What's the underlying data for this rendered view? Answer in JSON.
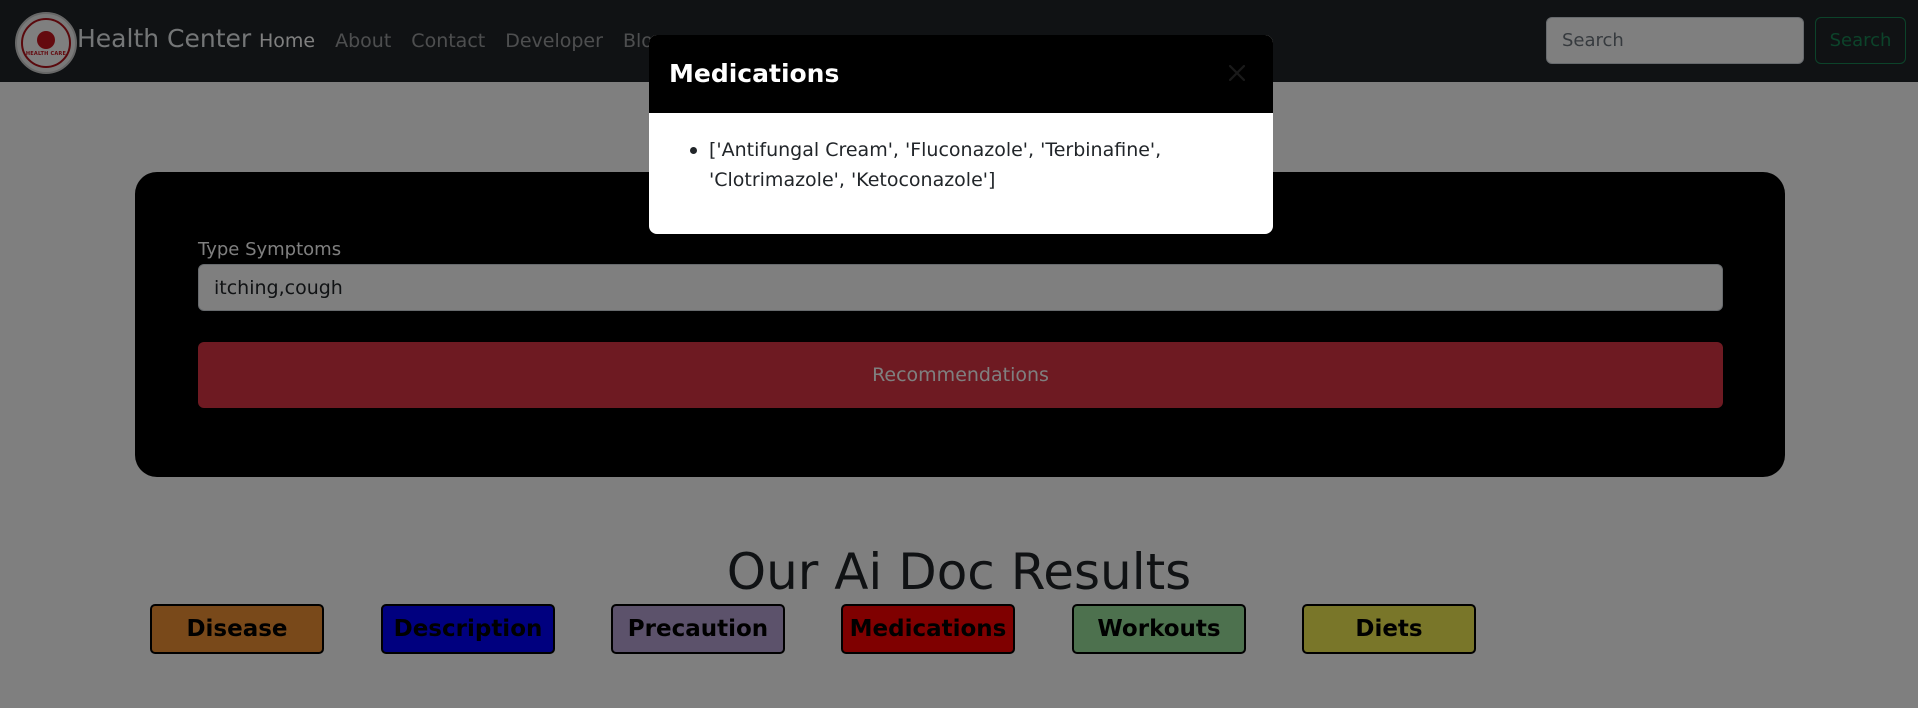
{
  "navbar": {
    "brand": "Health Center",
    "logo_text": "HEALTH CARE",
    "links": [
      {
        "label": "Home"
      },
      {
        "label": "About"
      },
      {
        "label": "Contact"
      },
      {
        "label": "Developer"
      },
      {
        "label": "Blog"
      }
    ],
    "search_placeholder": "Search",
    "search_button": "Search"
  },
  "form": {
    "label": "Type Symptoms",
    "symptoms_value": "itching,cough",
    "submit_button": "Recommendations"
  },
  "results": {
    "title": "Our Ai Doc Results",
    "buttons": [
      {
        "label": "Disease",
        "color": "#F39334"
      },
      {
        "label": "Description",
        "color": "#0000FF"
      },
      {
        "label": "Precaution",
        "color": "#B8A4D6"
      },
      {
        "label": "Medications",
        "color": "#FF0000"
      },
      {
        "label": "Workouts",
        "color": "#9BE39C"
      },
      {
        "label": "Diets",
        "color": "#F2EC53"
      }
    ]
  },
  "modal": {
    "title": "Medications",
    "close_icon": "close-icon",
    "items": [
      "['Antifungal Cream', 'Fluconazole', 'Terbinafine', 'Clotrimazole', 'Ketoconazole']"
    ]
  },
  "colors": {
    "navbar_bg": "#212529",
    "card_bg": "#000000",
    "danger": "#DC3545",
    "success": "#198754"
  }
}
